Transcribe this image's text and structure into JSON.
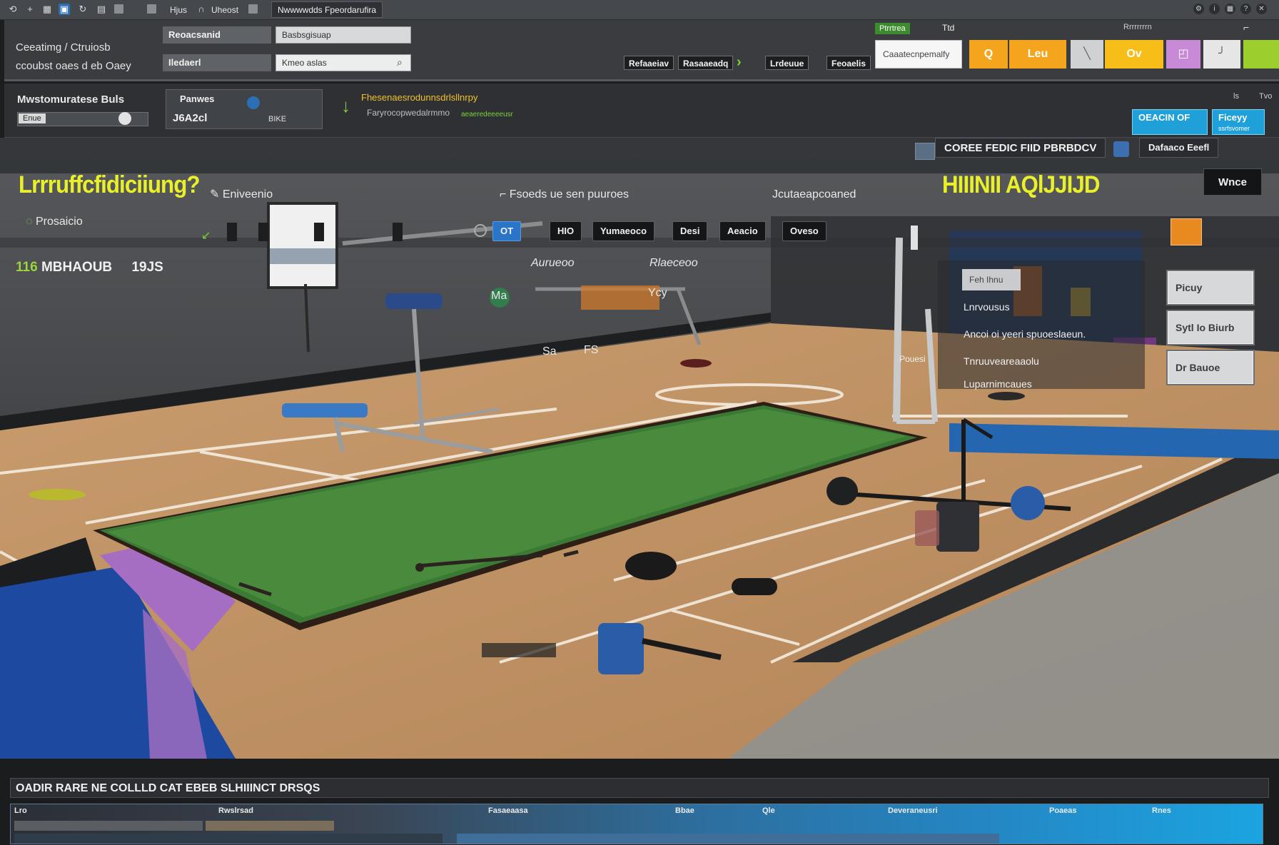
{
  "titlebar": {
    "app_icons": [
      "refresh-icon",
      "add-icon",
      "grid-icon",
      "save-icon",
      "history-icon",
      "tile-icon"
    ],
    "label_a": "Hjus",
    "label_b": "Uheost",
    "title": "Nwwwwdds Fpeordarufira"
  },
  "ribbon1": {
    "breadcrumb_line1": "Ceeatimg / Ctruiosb",
    "breadcrumb_line2": "ccoubst oaes d eb Oaey",
    "field1_label": "Reoacsanid",
    "field1_value": "Basbsgisuap",
    "field2_label": "Iledaerl",
    "field2_value": "Kmeo aslas",
    "toolbar_btn1": "Refaaeiav",
    "toolbar_btn2": "Rasaaeadq",
    "toolbar_btn3": "Lrdeuue",
    "toolbar_btn4": "Feoaelis",
    "search_tag": "Ptrrtrea",
    "search_count": "Ttd",
    "search_text": "Caaatecnpemalfy",
    "top_right_label": "Rrrrrrrrn",
    "tiles": [
      "Q",
      "Leu",
      "",
      "Ov",
      "",
      "",
      ""
    ],
    "colors": {
      "orange": "#f5a51d",
      "yellow": "#f7be1a",
      "violet": "#c88ad6",
      "lime": "#9ccf2e",
      "grey": "#cfd1d3",
      "white": "#e6e6e6"
    }
  },
  "ribbon2": {
    "title": "Mwstomuratese Buls",
    "chip": "Enue",
    "panel_title": "Panwes",
    "panel_value": "J6A2cl",
    "panel_unit": "BIKE",
    "note": "Fhesenaesrodunnsdrlsllnrpy",
    "note2": "Faryrocopwedalrmmo",
    "note3": "aeaeredeeeeusr",
    "mini1": "ls",
    "mini2": "Tvo",
    "cyan1": "OEACIN OF",
    "cyan2": "Ficeyy",
    "cyan2_sub": "ssrfsvomer"
  },
  "scene": {
    "headline_left": "Lrrruffcfidiciiung?",
    "headline_right": "HIIINII AQlJJIJD",
    "edit_label": "Eniveenio",
    "pin_label": "Fsoeds ue sen puuroes",
    "quick_label": "Jcutaeapcoaned",
    "sub_label": "Prosaicio",
    "stat_value": "116",
    "stat_name": "MBHAOUB",
    "stat_unit": "19JS",
    "pills": [
      "OT",
      "HIO",
      "Yumaeoco",
      "Desi",
      "Aeacio",
      "Oveso"
    ],
    "italic1": "Aurueoo",
    "italic2": "Rlaeceoo",
    "measure1": "Ma",
    "measure2": "Ycy",
    "measure3": "Sa",
    "measure4": "FS",
    "right_tab": "COREE FEDIC FIID PBRBDCV",
    "right_tab2": "Dafaaco Eeefl",
    "mode_button": "Wnce",
    "side_buttons": [
      "Picuy",
      "Sytl Io Biurb",
      "Dr Bauoe"
    ],
    "list_chip": "Feh Ihnu",
    "list_items": [
      "Lnrvousus",
      "Ancoi oi yeeri spuoeslaeun.",
      "Tnruuveareaaolu",
      "Luparnimcaues"
    ],
    "list_side": "Pouesi"
  },
  "bottom": {
    "title": "OADIR RARE NE COLLLD CAT EBEB SLHIIINCT DRSQS",
    "columns": [
      "Lro",
      "Rwslrsad",
      "Fasaeaasa",
      "Bbae",
      "Qle",
      "Deveraneusri",
      "Poaeas",
      "Rnes"
    ]
  }
}
